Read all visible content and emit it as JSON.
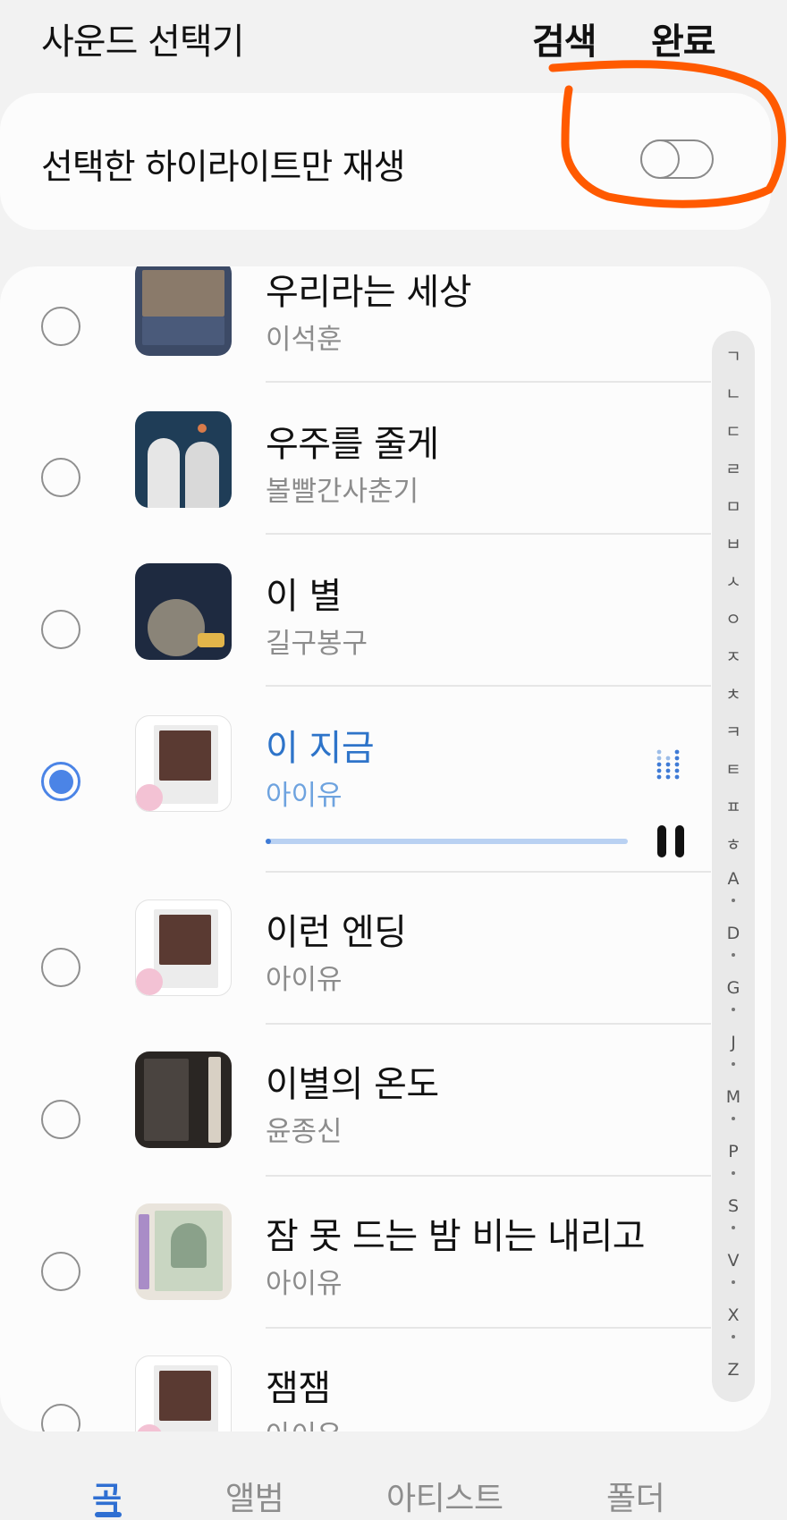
{
  "header": {
    "title": "사운드 선택기",
    "search_label": "검색",
    "done_label": "완료"
  },
  "highlight": {
    "label": "선택한 하이라이트만 재생",
    "toggle_on": false
  },
  "colors": {
    "accent": "#2f6fd2",
    "annotation": "#ff5a00",
    "selected_radio": "#4b84e6"
  },
  "songs": [
    {
      "title": "우리라는 세상",
      "artist": "이석훈",
      "selected": false
    },
    {
      "title": "우주를 줄게",
      "artist": "볼빨간사춘기",
      "selected": false
    },
    {
      "title": "이 별",
      "artist": "길구봉구",
      "selected": false
    },
    {
      "title": "이 지금",
      "artist": "아이유",
      "selected": true
    },
    {
      "title": "이런 엔딩",
      "artist": "아이유",
      "selected": false
    },
    {
      "title": "이별의 온도",
      "artist": "윤종신",
      "selected": false
    },
    {
      "title": "잠 못 드는 밤 비는 내리고",
      "artist": "아이유",
      "selected": false
    },
    {
      "title": "잼잼",
      "artist": "아이유",
      "selected": false
    }
  ],
  "playback": {
    "progress": 0.01,
    "state_icon": "pause-icon"
  },
  "index_letters": [
    "ㄱ",
    "ㄴ",
    "ㄷ",
    "ㄹ",
    "ㅁ",
    "ㅂ",
    "ㅅ",
    "ㅇ",
    "ㅈ",
    "ㅊ",
    "ㅋ",
    "ㅌ",
    "ㅍ",
    "ㅎ",
    "A",
    "D",
    "G",
    "J",
    "M",
    "P",
    "S",
    "V",
    "X",
    "Z"
  ],
  "tabs": [
    {
      "label": "곡",
      "active": true
    },
    {
      "label": "앨범",
      "active": false
    },
    {
      "label": "아티스트",
      "active": false
    },
    {
      "label": "폴더",
      "active": false
    }
  ]
}
